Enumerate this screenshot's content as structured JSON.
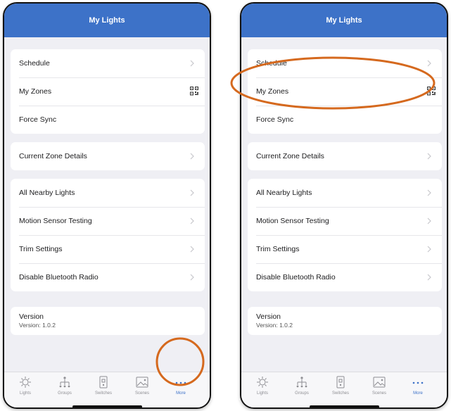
{
  "screen": {
    "title": "My Lights",
    "groups": [
      [
        {
          "label": "Schedule",
          "accessory": "chevron-right-icon"
        },
        {
          "label": "My Zones",
          "accessory": "qr-code-icon"
        },
        {
          "label": "Force Sync",
          "accessory": ""
        }
      ],
      [
        {
          "label": "Current Zone Details",
          "accessory": "chevron-right-icon"
        }
      ],
      [
        {
          "label": "All Nearby Lights",
          "accessory": "chevron-right-icon"
        },
        {
          "label": "Motion Sensor Testing",
          "accessory": "chevron-right-icon"
        },
        {
          "label": "Trim Settings",
          "accessory": "chevron-right-icon"
        },
        {
          "label": "Disable Bluetooth Radio",
          "accessory": "chevron-right-icon"
        }
      ]
    ],
    "version": {
      "title": "Version",
      "value": "Version: 1.0.2"
    },
    "tabs": [
      {
        "label": "Lights",
        "icon": "light-bulb-icon"
      },
      {
        "label": "Groups",
        "icon": "groups-icon"
      },
      {
        "label": "Switches",
        "icon": "switch-icon"
      },
      {
        "label": "Scenes",
        "icon": "scenes-icon"
      },
      {
        "label": "More",
        "icon": "more-dots-icon",
        "active": true
      }
    ]
  },
  "colors": {
    "nav_bar": "#3d72c8",
    "background": "#efeff4",
    "active_tab": "#3d72c8",
    "annotation": "#d5691e"
  },
  "annotations": [
    {
      "phone": "left",
      "target": "More tab",
      "shape": "circle"
    },
    {
      "phone": "right",
      "target": "My Zones row",
      "shape": "ellipse"
    }
  ]
}
